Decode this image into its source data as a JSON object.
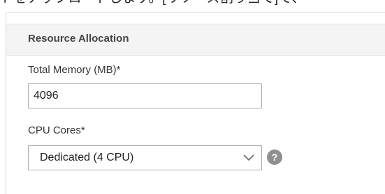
{
  "top_text": "トをアップロードします。[リソース割り当て]で、",
  "panel": {
    "title": "Resource Allocation"
  },
  "fields": {
    "memory": {
      "label": "Total Memory (MB)*",
      "value": "4096"
    },
    "cpu": {
      "label": "CPU Cores*",
      "selected": "Dedicated (4 CPU)"
    }
  },
  "icons": {
    "dropdown": "chevron-down-icon",
    "help": "help-icon"
  },
  "help_glyph": "?"
}
